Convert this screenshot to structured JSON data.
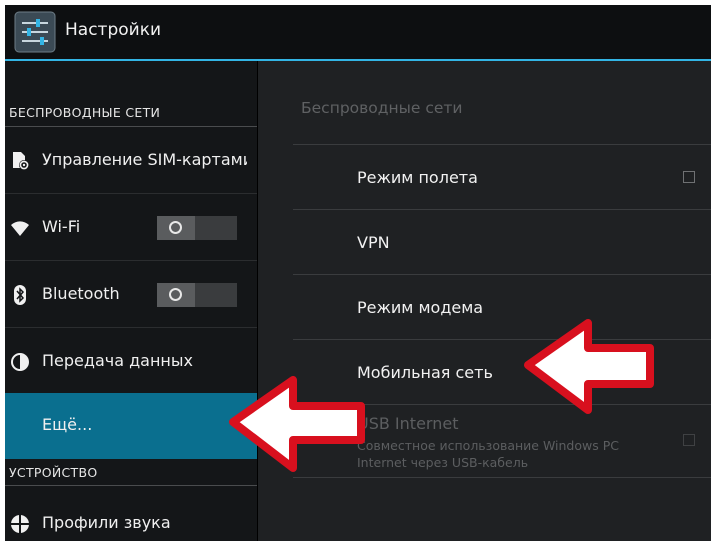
{
  "app": {
    "title": "Настройки",
    "icon": "settings-sliders-icon"
  },
  "sidebar": {
    "sections": [
      {
        "header": "БЕСПРОВОДНЫЕ СЕТИ"
      },
      {
        "header": "УСТРОЙСТВО"
      }
    ],
    "items": [
      {
        "label": "Управление SIM-картами",
        "icon": "sim-settings-icon"
      },
      {
        "label": "Wi-Fi",
        "icon": "wifi-icon",
        "toggle": "off"
      },
      {
        "label": "Bluetooth",
        "icon": "bluetooth-icon",
        "toggle": "off"
      },
      {
        "label": "Передача данных",
        "icon": "data-usage-icon"
      },
      {
        "label": "Ещё...",
        "selected": true
      },
      {
        "label": "Профили звука",
        "icon": "sound-profiles-icon"
      }
    ]
  },
  "detail": {
    "header": "Беспроводные сети",
    "items": [
      {
        "label": "Режим полета",
        "checkbox": false
      },
      {
        "label": "VPN"
      },
      {
        "label": "Режим модема"
      },
      {
        "label": "Мобильная сеть"
      },
      {
        "label": "USB Internet",
        "summary_line1": "Совместное использование Windows PC",
        "summary_line2": "Internet через USB-кабель",
        "checkbox": false,
        "enabled": false
      }
    ]
  },
  "colors": {
    "accent": "#33b5e5",
    "selected_item": "#0a6f8f",
    "annotation_arrow": "#d8101e"
  }
}
